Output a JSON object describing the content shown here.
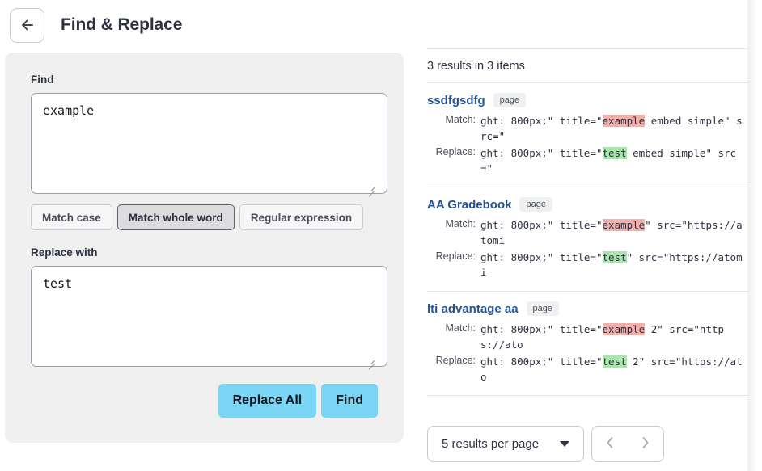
{
  "header": {
    "title": "Find & Replace",
    "back_icon": "arrow-left-icon"
  },
  "find_panel": {
    "find_label": "Find",
    "find_value": "example",
    "find_placeholder": "",
    "replace_label": "Replace with",
    "replace_value": "test",
    "replace_placeholder": "",
    "options": [
      {
        "label": "Match case",
        "active": false
      },
      {
        "label": "Match whole word",
        "active": true
      },
      {
        "label": "Regular expression",
        "active": false
      }
    ],
    "replace_all_label": "Replace All",
    "find_button_label": "Find"
  },
  "results": {
    "summary": "3 results in 3 items",
    "match_key": "Match:",
    "replace_key": "Replace:",
    "items": [
      {
        "title": "ssdfgsdfg",
        "badge": "page",
        "match_prefix": "ght: 800px;\" title=\"",
        "match_highlight": "example",
        "match_suffix": " embed simple\" src=\"",
        "replace_prefix": "ght: 800px;\" title=\"",
        "replace_highlight": "test",
        "replace_suffix": " embed simple\" src=\""
      },
      {
        "title": "AA Gradebook",
        "badge": "page",
        "match_prefix": "ght: 800px;\" title=\"",
        "match_highlight": "example",
        "match_suffix": "\" src=\"https://atomi",
        "replace_prefix": "ght: 800px;\" title=\"",
        "replace_highlight": "test",
        "replace_suffix": "\" src=\"https://atomi"
      },
      {
        "title": "lti advantage aa",
        "badge": "page",
        "match_prefix": "ght: 800px;\" title=\"",
        "match_highlight": "example",
        "match_suffix": " 2\" src=\"https://ato",
        "replace_prefix": "ght: 800px;\" title=\"",
        "replace_highlight": "test",
        "replace_suffix": " 2\" src=\"https://ato"
      }
    ]
  },
  "pagination": {
    "per_page_label": "5 results per page",
    "prev_icon": "chevron-left-icon",
    "next_icon": "chevron-right-icon",
    "prev_disabled": true,
    "next_disabled": true
  },
  "colors": {
    "accent_button": "#7bd5f5",
    "link": "#24538f",
    "match_highlight": "#f0b0ac",
    "replace_highlight": "#abe5ae",
    "panel_bg": "#f0f0f0",
    "divider": "#e3e5e8"
  }
}
